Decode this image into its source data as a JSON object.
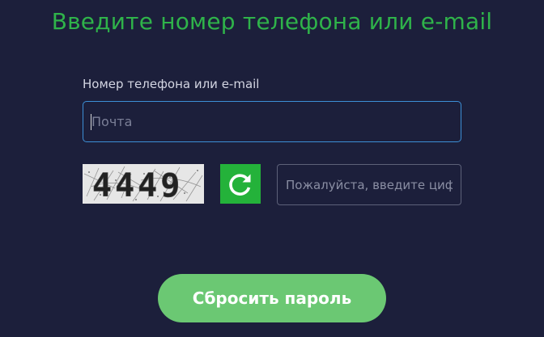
{
  "title": "Введите номер телефона или e-mail",
  "form": {
    "label": "Номер телефона или e-mail",
    "contact_value": "",
    "contact_placeholder": "Почта",
    "captcha_code": "4449",
    "captcha_placeholder": "Пожалуйста, введите цифры",
    "submit_label": "Сбросить пароль"
  },
  "icons": {
    "refresh": "refresh-icon"
  },
  "colors": {
    "background": "#1c1f3b",
    "accent": "#2fb34a",
    "refresh_button": "#24b23a",
    "submit_button": "#6bc873",
    "input_focus_border": "#3c8fd6"
  }
}
